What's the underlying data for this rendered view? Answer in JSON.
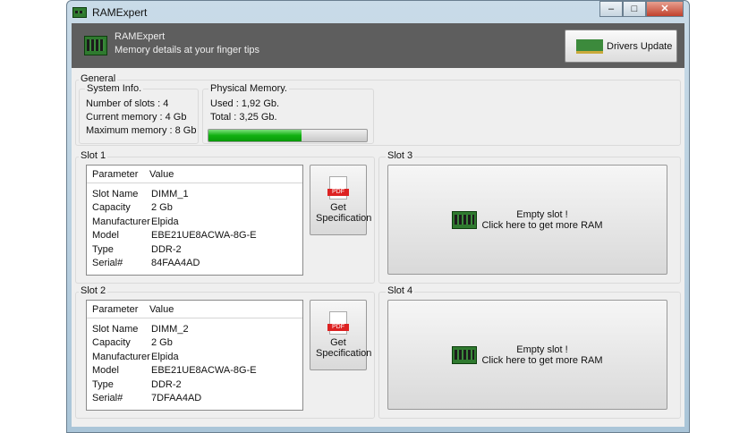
{
  "window": {
    "title": "RAMExpert",
    "controls": [
      "minimize",
      "maximize",
      "close"
    ]
  },
  "header": {
    "app_name": "RAMExpert",
    "tagline": "Memory details at your finger tips",
    "drivers_button": "Drivers Update"
  },
  "general": {
    "label": "General",
    "system_info": {
      "label": "System Info.",
      "lines": [
        "Number of slots : 4",
        "Current memory : 4 Gb",
        "Maximum memory : 8 Gb"
      ]
    },
    "physical_memory": {
      "label": "Physical Memory.",
      "used": "Used : 1,92 Gb.",
      "total": "Total : 3,25 Gb.",
      "usage_percent": 59
    }
  },
  "slots": [
    {
      "label": "Slot 1",
      "headers": [
        "Parameter",
        "Value"
      ],
      "rows": [
        [
          "Slot Name",
          "DIMM_1"
        ],
        [
          "Capacity",
          "2 Gb"
        ],
        [
          "Manufacturer",
          "Elpida"
        ],
        [
          "Model",
          "EBE21UE8ACWA-8G-E"
        ],
        [
          "Type",
          "DDR-2"
        ],
        [
          "Serial#",
          "84FAA4AD"
        ]
      ],
      "button": "Get Specification",
      "pdf": "PDF"
    },
    {
      "label": "Slot 2",
      "headers": [
        "Parameter",
        "Value"
      ],
      "rows": [
        [
          "Slot Name",
          "DIMM_2"
        ],
        [
          "Capacity",
          "2 Gb"
        ],
        [
          "Manufacturer",
          "Elpida"
        ],
        [
          "Model",
          "EBE21UE8ACWA-8G-E"
        ],
        [
          "Type",
          "DDR-2"
        ],
        [
          "Serial#",
          "7DFAA4AD"
        ]
      ],
      "button": "Get Specification",
      "pdf": "PDF"
    },
    {
      "label": "Slot 3",
      "empty1": "Empty slot !",
      "empty2": "Click here to get more RAM"
    },
    {
      "label": "Slot 4",
      "empty1": "Empty slot !",
      "empty2": "Click here to get more RAM"
    }
  ]
}
